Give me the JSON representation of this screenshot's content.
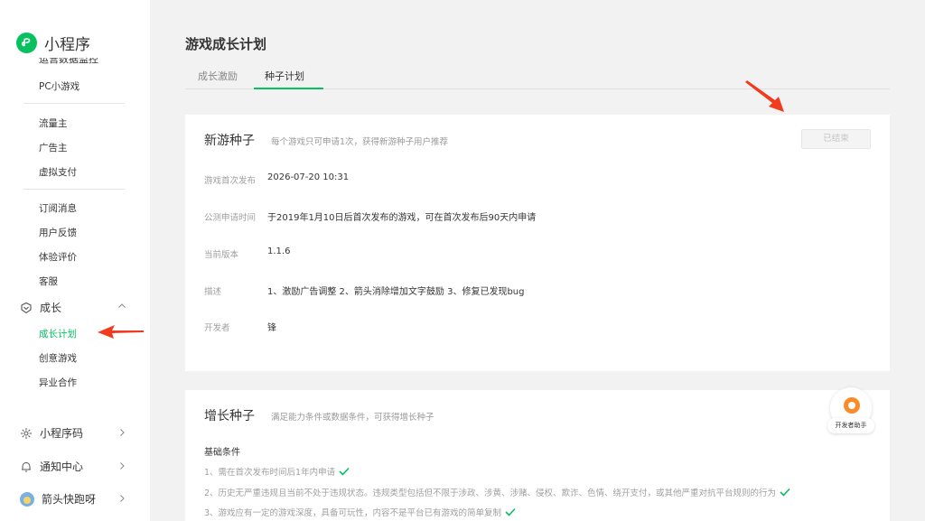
{
  "app": {
    "logo_text": "小程序"
  },
  "sidebar": {
    "clipped_item": "运营数据监控",
    "items": [
      {
        "label": "PC小游戏"
      },
      {
        "label": "流量主"
      },
      {
        "label": "广告主"
      },
      {
        "label": "虚拟支付"
      },
      {
        "label": "订阅消息"
      },
      {
        "label": "用户反馈"
      },
      {
        "label": "体验评价"
      },
      {
        "label": "客服"
      }
    ],
    "growth_group": {
      "label": "成长",
      "icon": "growth-icon"
    },
    "growth_items": [
      {
        "label": "成长计划",
        "active": true
      },
      {
        "label": "创意游戏"
      },
      {
        "label": "异业合作"
      }
    ],
    "bottom": [
      {
        "label": "小程序码",
        "icon": "qrcode-icon"
      },
      {
        "label": "通知中心",
        "icon": "bell-icon"
      },
      {
        "label": "箭头快跑呀",
        "icon": "avatar"
      }
    ]
  },
  "page": {
    "title": "游戏成长计划",
    "tabs": [
      {
        "label": "成长激励",
        "active": false
      },
      {
        "label": "种子计划",
        "active": true
      }
    ]
  },
  "seed_card": {
    "title": "新游种子",
    "desc": "每个游戏只可申请1次，获得新游种子用户推荐",
    "button": "已结束",
    "rows": [
      {
        "label": "游戏首次发布",
        "value": "2026-07-20 10:31"
      },
      {
        "label": "公测申请时间",
        "value": "于2019年1月10日后首次发布的游戏，可在首次发布后90天内申请"
      },
      {
        "label": "当前版本",
        "value": "1.1.6"
      },
      {
        "label": "描述",
        "value": "1、激励广告调整 2、箭头消除增加文字鼓励 3、修复已发现bug"
      },
      {
        "label": "开发者",
        "value": "锋"
      }
    ]
  },
  "growth_card": {
    "title": "增长种子",
    "desc": "满足能力条件或数据条件，可获得增长种子",
    "conditions_title": "基础条件",
    "conditions": [
      "1、需在首次发布时间后1年内申请",
      "2、历史无严重违规且当前不处于违规状态。违规类型包括但不限于涉政、涉黄、涉赌、侵权、欺诈、色情、绕开支付，或其他严重对抗平台规则的行为",
      "3、游戏应有一定的游戏深度，具备可玩性，内容不是平台已有游戏的简单复制"
    ]
  },
  "helper": {
    "label": "开发者助手"
  },
  "colors": {
    "accent": "#07c160",
    "arrow": "#f23a1e",
    "helper": "#fa8c28"
  }
}
